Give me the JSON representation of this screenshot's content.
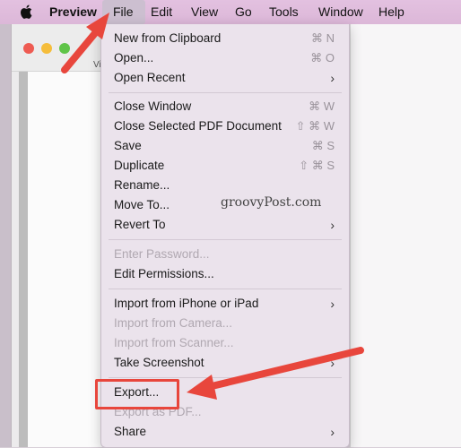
{
  "menubar": {
    "app_name": "Preview",
    "items": [
      "File",
      "Edit",
      "View",
      "Go",
      "Tools",
      "Window",
      "Help"
    ]
  },
  "window": {
    "view_label": "Vi"
  },
  "file_menu": {
    "items": [
      {
        "label": "New from Clipboard",
        "shortcut": "⌘ N"
      },
      {
        "label": "Open...",
        "shortcut": "⌘ O"
      },
      {
        "label": "Open Recent",
        "submenu": true
      },
      {
        "label": "Close Window",
        "shortcut": "⌘ W"
      },
      {
        "label": "Close Selected PDF Document",
        "shortcut": "⇧ ⌘ W"
      },
      {
        "label": "Save",
        "shortcut": "⌘ S"
      },
      {
        "label": "Duplicate",
        "shortcut": "⇧ ⌘ S"
      },
      {
        "label": "Rename..."
      },
      {
        "label": "Move To..."
      },
      {
        "label": "Revert To",
        "submenu": true
      },
      {
        "label": "Enter Password...",
        "disabled": true
      },
      {
        "label": "Edit Permissions..."
      },
      {
        "label": "Import from iPhone or iPad",
        "submenu": true
      },
      {
        "label": "Import from Camera...",
        "disabled": true
      },
      {
        "label": "Import from Scanner...",
        "disabled": true
      },
      {
        "label": "Take Screenshot",
        "submenu": true
      },
      {
        "label": "Export..."
      },
      {
        "label": "Export as PDF...",
        "disabled": true
      },
      {
        "label": "Share",
        "submenu": true
      }
    ]
  },
  "watermark": "groovyPost.com",
  "colors": {
    "annotation": "#e8463c",
    "menubar": "#dcb7d8"
  }
}
